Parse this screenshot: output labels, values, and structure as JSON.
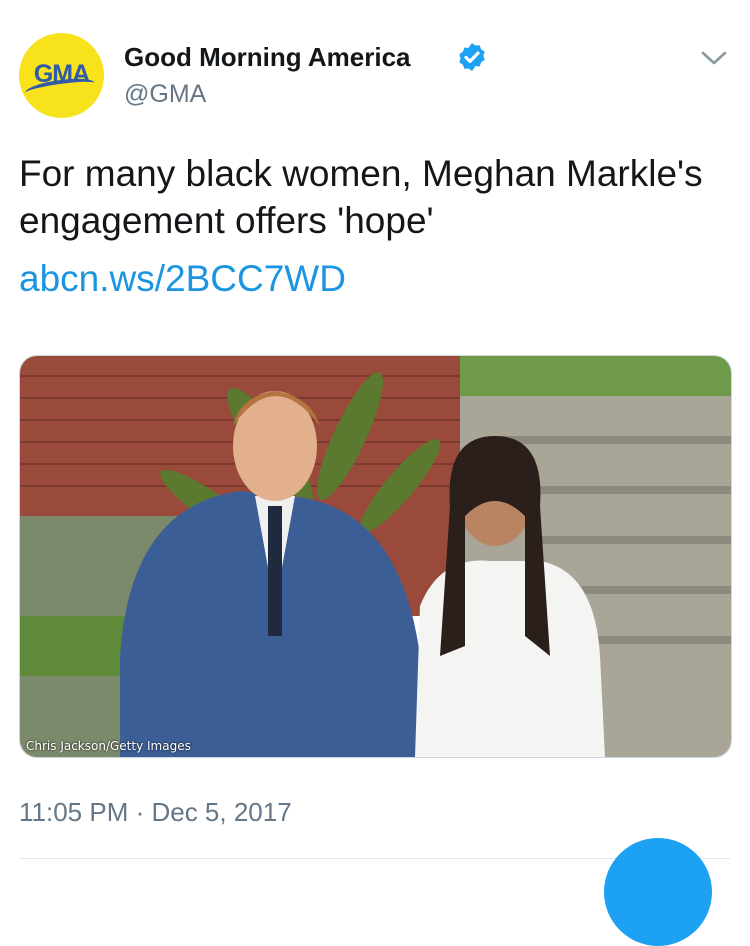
{
  "tweet": {
    "avatar_text": "GMA",
    "name": "Good Morning America",
    "handle": "@GMA",
    "verified_icon": "verified-badge-icon",
    "menu_icon": "chevron-down-icon",
    "text": "For many black women, Meghan Markle's engagement offers 'hope'",
    "link": "abcn.ws/2BCC7WD",
    "media_credit": "Chris Jackson/Getty Images",
    "timestamp": "11:05 PM · Dec 5, 2017"
  },
  "colors": {
    "link": "#1b95e0",
    "secondary_text": "#657786",
    "verified": "#1da1f2",
    "avatar_bg": "#f7e21c",
    "avatar_text": "#2f5aa8"
  }
}
